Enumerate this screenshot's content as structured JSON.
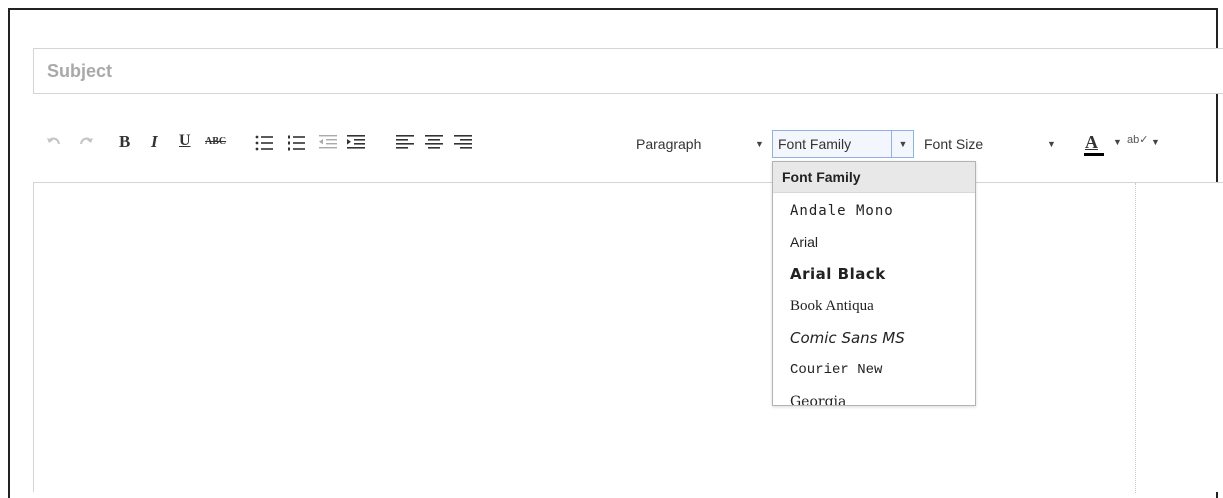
{
  "subject": {
    "placeholder": "Subject"
  },
  "toolbar": {
    "undo_icon": "undo-icon",
    "redo_icon": "redo-icon",
    "bold_label": "B",
    "italic_label": "I",
    "underline_label": "U",
    "strike_label": "ABC",
    "bullist_icon": "bullet-list-icon",
    "numlist_icon": "numbered-list-icon",
    "outdent_icon": "outdent-icon",
    "indent_icon": "indent-icon",
    "align_left_icon": "align-left-icon",
    "align_center_icon": "align-center-icon",
    "align_right_icon": "align-right-icon",
    "format_select": "Paragraph",
    "font_family_select": "Font Family",
    "font_size_select": "Font Size",
    "forecolor_label": "A",
    "spellcheck_label": "ab✓"
  },
  "font_family_menu": {
    "header": "Font Family",
    "items": [
      "Andale Mono",
      "Arial",
      "Arial Black",
      "Book Antiqua",
      "Comic Sans MS",
      "Courier New",
      "Georgia"
    ]
  },
  "colors": {
    "accent_border": "#8fb2e0",
    "menu_header_bg": "#e8e8e8",
    "placeholder": "#a9a9a9"
  }
}
